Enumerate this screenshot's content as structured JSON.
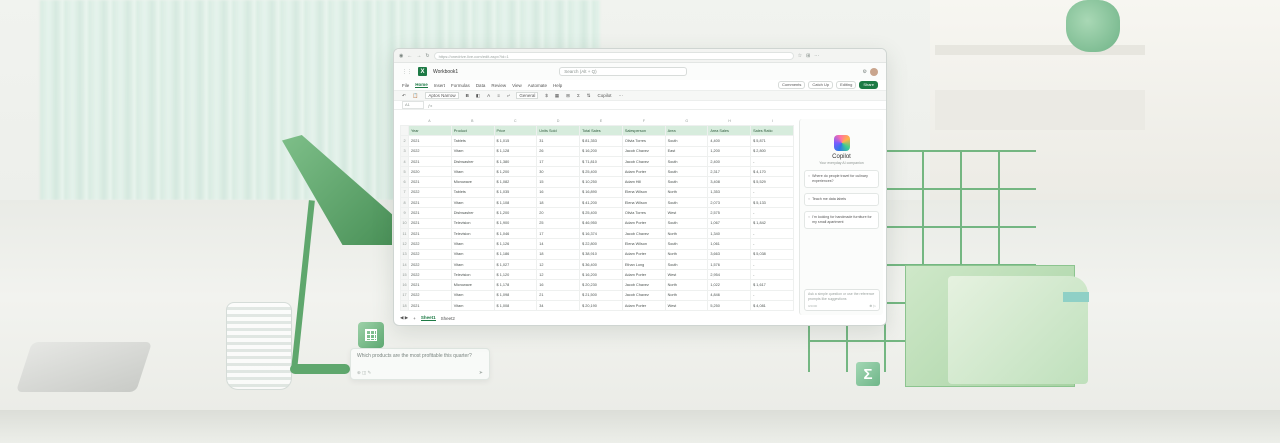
{
  "browser": {
    "url": "https://onedrive.live.com/edit.aspx?id=1"
  },
  "app": {
    "document_name": "Workbook1",
    "search_placeholder": "Search (Alt + Q)",
    "header_buttons": [
      "Comments",
      "Catch Up",
      "Editing",
      "Share"
    ],
    "ribbon_tabs": [
      "File",
      "Home",
      "Insert",
      "Formulas",
      "Data",
      "Review",
      "View",
      "Automate",
      "Help"
    ],
    "active_tab": "Home",
    "toolbar": {
      "font": "Aptos Narrow",
      "number_format": "General",
      "copilot_label": "Copilot"
    }
  },
  "sheet": {
    "column_letters": [
      "A",
      "B",
      "C",
      "D",
      "E",
      "F",
      "G",
      "H",
      "I"
    ],
    "headers": [
      "Year",
      "Product",
      "Price",
      "Units Sold",
      "Total Sales",
      "Salesperson",
      "Area",
      "Area Sales",
      "Sales Ratio"
    ],
    "rows": [
      [
        "2021",
        "Tablets",
        "$ 1,015",
        "31",
        "$ 81,353",
        "Olivia Torres",
        "South",
        "4,400",
        "$ 5,871"
      ],
      [
        "2022",
        "Vitam",
        "$ 1,128",
        "26",
        "$ 16,200",
        "Jacob Chavez",
        "East",
        "1,200",
        "$ 2,800"
      ],
      [
        "2021",
        "Dishwasher",
        "$ 1,380",
        "17",
        "$ 71,810",
        "Jacob Chavez",
        "South",
        "2,400",
        "-"
      ],
      [
        "2020",
        "Vitam",
        "$ 1,200",
        "30",
        "$ 25,400",
        "Adam Porter",
        "South",
        "2,317",
        "$ 4,170"
      ],
      [
        "2021",
        "Microwave",
        "$ 1,082",
        "15",
        "$ 10,250",
        "Adam Hill",
        "South",
        "3,408",
        "$ 5,529"
      ],
      [
        "2022",
        "Tablets",
        "$ 1,035",
        "16",
        "$ 16,890",
        "Elena Wilson",
        "North",
        "1,353",
        "-"
      ],
      [
        "2021",
        "Vitam",
        "$ 1,108",
        "18",
        "$ 41,200",
        "Elena Wilson",
        "South",
        "2,073",
        "$ 5,133"
      ],
      [
        "2021",
        "Dishwasher",
        "$ 1,200",
        "20",
        "$ 25,400",
        "Olivia Torres",
        "West",
        "2,575",
        "-"
      ],
      [
        "2021",
        "Television",
        "$ 1,900",
        "25",
        "$ 46,950",
        "Adam Porter",
        "South",
        "1,067",
        "$ 1,842"
      ],
      [
        "2021",
        "Television",
        "$ 1,046",
        "17",
        "$ 16,374",
        "Jacob Chavez",
        "North",
        "1,340",
        "-"
      ],
      [
        "2022",
        "Vitam",
        "$ 1,126",
        "14",
        "$ 22,800",
        "Elena Wilson",
        "South",
        "1,061",
        "-"
      ],
      [
        "2022",
        "Vitam",
        "$ 1,186",
        "18",
        "$ 38,910",
        "Adam Porter",
        "North",
        "3,663",
        "$ 5,038"
      ],
      [
        "2022",
        "Vitam",
        "$ 1,027",
        "12",
        "$ 36,400",
        "Ethan Long",
        "South",
        "1,576",
        "-"
      ],
      [
        "2022",
        "Television",
        "$ 1,120",
        "12",
        "$ 16,200",
        "Adam Porter",
        "West",
        "2,954",
        "-"
      ],
      [
        "2021",
        "Microwave",
        "$ 1,178",
        "16",
        "$ 20,230",
        "Jacob Chavez",
        "North",
        "1,022",
        "$ 1,617"
      ],
      [
        "2022",
        "Vitam",
        "$ 1,098",
        "21",
        "$ 21,500",
        "Jacob Chavez",
        "North",
        "4,846",
        "-"
      ],
      [
        "2021",
        "Vitam",
        "$ 1,008",
        "34",
        "$ 20,190",
        "Adam Porter",
        "West",
        "5,250",
        "$ 4,081"
      ]
    ],
    "sheet_tabs": [
      "Sheet1",
      "Sheet2"
    ]
  },
  "copilot": {
    "title": "Copilot",
    "subtitle": "Your everyday AI companion",
    "suggestions": [
      "Where do people travel for culinary experiences?",
      "Teach me data labels",
      "I'm looking for handmade furniture for my small apartment"
    ],
    "input_placeholder": "Ask a simple question or use the reference prompts like suggestions",
    "char_count": "0/2000"
  },
  "floating_prompt": {
    "question": "Which products are the most profitable this quarter?"
  },
  "decor": {
    "sigma": "Σ"
  },
  "colors": {
    "excel_green": "#1d7a45",
    "header_fill": "#d7ecdd",
    "decor_green": "#5fa76d"
  }
}
